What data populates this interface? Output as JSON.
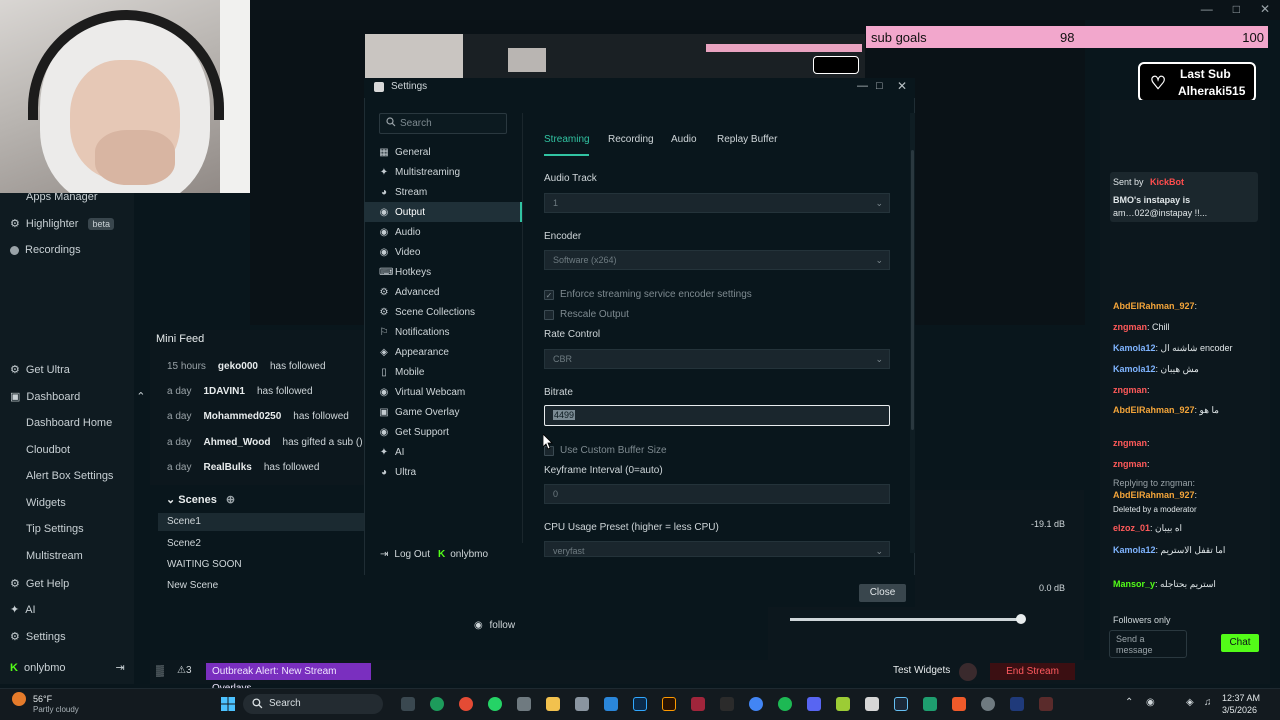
{
  "top_overlay": {
    "sub_goal_label": "sub goals",
    "sub_goal_current": "98",
    "sub_goal_max": "100",
    "last_sub_title": "Last Sub",
    "last_sub_user": "Alheraki515"
  },
  "left_nav": {
    "apps_manager": "Apps Manager",
    "highlighter": "Highlighter",
    "highlighter_badge": "beta",
    "recordings": "Recordings",
    "get_ultra": "Get Ultra",
    "dashboard": "Dashboard",
    "dashboard_home": "Dashboard Home",
    "cloudbot": "Cloudbot",
    "alert_box_settings": "Alert Box Settings",
    "widgets": "Widgets",
    "tip_settings": "Tip Settings",
    "multistream": "Multistream",
    "get_help": "Get Help",
    "ai": "AI",
    "settings": "Settings",
    "user": "onlybmo"
  },
  "mini_feed": {
    "title": "Mini Feed",
    "rows": [
      {
        "time": "15 hours",
        "user": "geko000",
        "action": "has followed"
      },
      {
        "time": "a day",
        "user": "1DAVIN1",
        "action": "has followed"
      },
      {
        "time": "a day",
        "user": "Mohammed0250",
        "action": "has followed"
      },
      {
        "time": "a day",
        "user": "Ahmed_Wood",
        "action": "has gifted a sub () to"
      },
      {
        "time": "a day",
        "user": "RealBulks",
        "action": "has followed"
      }
    ]
  },
  "scenes": {
    "title": "Scenes",
    "items": [
      "Scene1",
      "Scene2",
      "WAITING SOON",
      "New Scene"
    ]
  },
  "audio": {
    "db1": "-19.1 dB",
    "db2": "0.0 dB",
    "follow": "follow"
  },
  "chat": {
    "sent_by": "Sent by",
    "bot": "KickBot",
    "msg1": "BMO's instapay is",
    "msg2": "am…022@instapay !!...",
    "lines": [
      {
        "user": "AbdElRahman_927",
        "text": ":"
      },
      {
        "user": "zngman",
        "text": ": Chill"
      },
      {
        "user": "Kamola12",
        "text": ": شاشنه ال encoder"
      },
      {
        "user": "Kamola12",
        "text": ": مش هيبان"
      },
      {
        "user": "zngman",
        "text": ":"
      },
      {
        "user": "AbdElRahman_927",
        "text": ": ما هو"
      },
      {
        "user": "zngman",
        "text": ":"
      },
      {
        "user": "zngman",
        "text": ":"
      },
      {
        "user": "AbdElRahman_927",
        "text": ":"
      },
      {
        "user": "elzoz_01",
        "text": ": اه بيبان"
      },
      {
        "user": "Kamola12",
        "text": ": اما تقفل الاستريم"
      },
      {
        "user": "Mansor_y",
        "text": ": استريم بحتاجله"
      }
    ],
    "replying": "Replying to zngman:",
    "deleted": "Deleted by a moderator",
    "followers_only": "Followers only",
    "send_placeholder": "Send a message",
    "chat_button": "Chat"
  },
  "bottom_bar": {
    "alert_count": "3",
    "alert_text": "Outbreak Alert: New Stream Overlays",
    "test_widgets": "Test Widgets",
    "end_stream": "End Stream"
  },
  "taskbar": {
    "weather_temp": "56°F",
    "weather_desc": "Partly cloudy",
    "search": "Search",
    "time": "12:37 AM",
    "date": "3/5/2026"
  },
  "settings": {
    "title": "Settings",
    "search_placeholder": "Search",
    "categories": [
      "General",
      "Multistreaming",
      "Stream",
      "Output",
      "Audio",
      "Video",
      "Hotkeys",
      "Advanced",
      "Scene Collections",
      "Notifications",
      "Appearance",
      "Mobile",
      "Virtual Webcam",
      "Game Overlay",
      "Get Support",
      "AI",
      "Ultra"
    ],
    "active_category": "Output",
    "logout": "Log Out",
    "username": "onlybmo",
    "tabs": [
      "Streaming",
      "Recording",
      "Audio",
      "Replay Buffer"
    ],
    "active_tab": "Streaming",
    "fields": {
      "audio_track_label": "Audio Track",
      "audio_track_value": "1",
      "encoder_label": "Encoder",
      "encoder_value": "Software (x264)",
      "enforce_label": "Enforce streaming service encoder settings",
      "rescale_label": "Rescale Output",
      "rate_control_label": "Rate Control",
      "rate_control_value": "CBR",
      "bitrate_label": "Bitrate",
      "bitrate_value": "4499",
      "custom_buffer_label": "Use Custom Buffer Size",
      "keyframe_label": "Keyframe Interval (0=auto)",
      "keyframe_value": "0",
      "cpu_preset_label": "CPU Usage Preset (higher = less CPU)",
      "cpu_preset_value": "veryfast"
    },
    "close_button": "Close"
  }
}
